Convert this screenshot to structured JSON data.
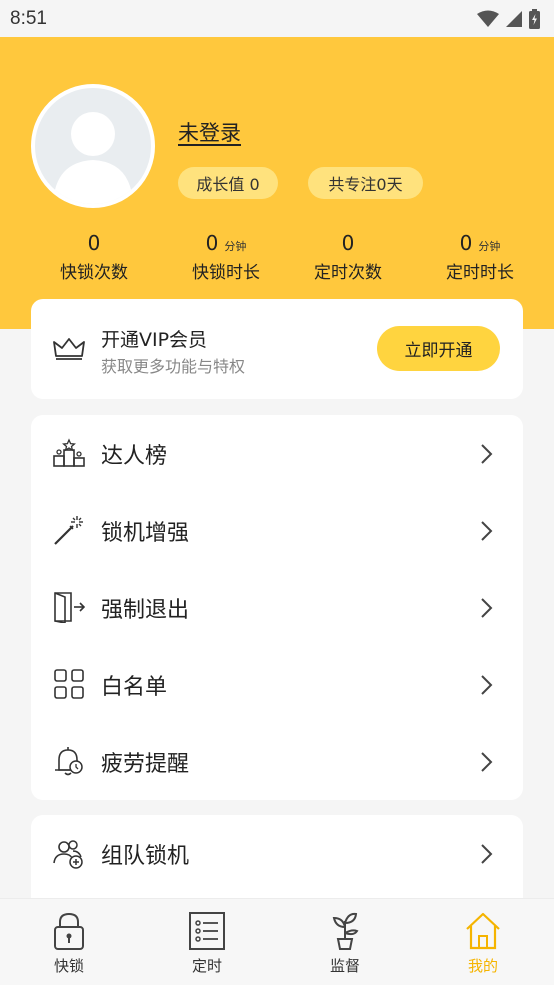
{
  "status_bar": {
    "time": "8:51"
  },
  "profile": {
    "username": "未登录",
    "growth_label": "成长值 0",
    "focus_label": "共专注0天"
  },
  "stats": [
    {
      "value": "0",
      "unit": "",
      "label": "快锁次数"
    },
    {
      "value": "0",
      "unit": "分钟",
      "label": "快锁时长"
    },
    {
      "value": "0",
      "unit": "",
      "label": "定时次数"
    },
    {
      "value": "0",
      "unit": "分钟",
      "label": "定时时长"
    }
  ],
  "vip": {
    "title": "开通VIP会员",
    "subtitle": "获取更多功能与特权",
    "button": "立即开通"
  },
  "menu": [
    {
      "label": "达人榜",
      "icon": "podium-icon"
    },
    {
      "label": "锁机增强",
      "icon": "magic-wand-icon"
    },
    {
      "label": "强制退出",
      "icon": "exit-door-icon"
    },
    {
      "label": "白名单",
      "icon": "grid-icon"
    },
    {
      "label": "疲劳提醒",
      "icon": "alarm-bell-icon"
    }
  ],
  "menu2": [
    {
      "label": "组队锁机",
      "icon": "group-add-icon"
    }
  ],
  "tabs": [
    {
      "label": "快锁",
      "icon": "lock-icon",
      "active": false
    },
    {
      "label": "定时",
      "icon": "list-icon",
      "active": false
    },
    {
      "label": "监督",
      "icon": "sprout-icon",
      "active": false
    },
    {
      "label": "我的",
      "icon": "home-icon",
      "active": true
    }
  ],
  "colors": {
    "header": "#ffc83d",
    "accent": "#f5b400",
    "vip_button": "#ffd43f",
    "background": "#f5f5f5"
  }
}
